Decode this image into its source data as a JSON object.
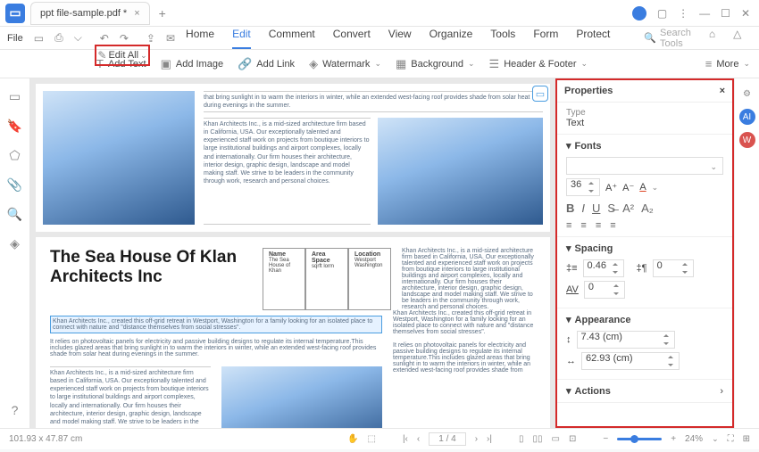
{
  "titlebar": {
    "tab_title": "ppt file-sample.pdf *"
  },
  "filebar": {
    "file": "File",
    "menu": [
      "Home",
      "Edit",
      "Comment",
      "Convert",
      "View",
      "Organize",
      "Tools",
      "Form",
      "Protect"
    ],
    "active": "Edit",
    "search_ph": "Search Tools"
  },
  "toolbar": {
    "edit_all": "Edit All",
    "add_text": "Add Text",
    "add_image": "Add Image",
    "add_link": "Add Link",
    "watermark": "Watermark",
    "background": "Background",
    "header_footer": "Header & Footer",
    "more": "More"
  },
  "doc": {
    "top_caption": "that bring sunlight in to warm the interiors in winter, while an extended west-facing roof provides shade from solar heat during evenings in the summer.",
    "mid_text": "Khan Architects Inc., is a mid-sized architecture firm based in California, USA. Our exceptionally talented and experienced staff work on projects from boutique interiors to large institutional buildings and airport complexes, locally and internationally. Our firm houses their architecture, interior design, graphic design, landscape and model making staff. We strive to be leaders in the community through work, research and personal choices.",
    "title": "The Sea House Of Klan Architects Inc",
    "table": {
      "h1": "Name",
      "h2": "Area Space",
      "h3": "Location",
      "v1": "The Sea House of Khan",
      "v2": "sqrft lorm",
      "v3": "Westport Washington"
    },
    "selected": "Khan Architects Inc., created this off-grid retreat in Westport, Washington for a family looking for an isolated place to connect with nature and \"distance themselves from social stresses\".",
    "below_sel": "It relies on photovoltaic panels for electricity and passive building designs to regulate its internal temperature.This includes glazed areas that bring sunlight in to warm the interiors in winter, while an extended west-facing roof provides shade from solar heat during evenings in the summer.",
    "col_left": "Khan Architects Inc., is a mid-sized architecture firm based in California, USA. Our exceptionally talented and experienced staff work on projects from boutique interiors to large institutional buildings and airport complexes, locally and internationally. Our firm houses their architecture, interior design, graphic design, landscape and model making staff. We strive to be leaders in the",
    "right1": "Khan Architects Inc., is a mid-sized architecture firm based in California, USA. Our exceptionally talented and experienced staff work on projects from boutique interiors to large institutional buildings and airport complexes, locally and internationally. Our firm houses their architecture, interior design, graphic design, landscape and model making staff. We strive to be leaders in the community through work, research and personal choices.",
    "right2": "Khan Architects Inc., created this off-grid retreat in Westport, Washington for a family looking for an isolated place to connect with nature and \"distance themselves from social stresses\".",
    "right3": "It relies on photovoltaic panels for electricity and passive building designs to regulate its internal temperature.This includes glazed areas that bring sunlight in to warm the interiors in winter, while an extended west-facing roof provides shade from"
  },
  "props": {
    "title": "Properties",
    "type_lbl": "Type",
    "type_val": "Text",
    "fonts_lbl": "Fonts",
    "size": "36",
    "spacing_lbl": "Spacing",
    "line_sp": "0.46",
    "para_sp": "0",
    "char_sp": "0",
    "appearance_lbl": "Appearance",
    "width": "7.43 (cm)",
    "height": "62.93 (cm)",
    "actions_lbl": "Actions"
  },
  "status": {
    "coords": "101.93 x 47.87 cm",
    "page": "1 / 4",
    "zoom": "24%"
  }
}
